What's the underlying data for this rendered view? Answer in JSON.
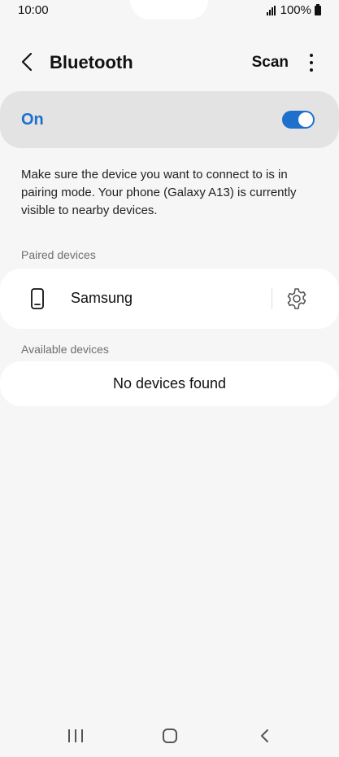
{
  "status_bar": {
    "time": "10:00",
    "battery": "100%",
    "icons": [
      "signal-icon",
      "battery-icon"
    ]
  },
  "header": {
    "title": "Bluetooth",
    "scan_label": "Scan",
    "icons": [
      "back-arrow-icon",
      "more-options-icon"
    ]
  },
  "master_switch": {
    "label": "On",
    "state": "on",
    "accent_color": "#1f6fcd"
  },
  "description": "Make sure the device you want to connect to is in pairing mode. Your phone (Galaxy A13) is currently visible to nearby devices.",
  "paired_devices": {
    "label": "Paired devices",
    "items": [
      {
        "name": "Samsung",
        "icon": "phone-icon",
        "action_icon": "gear-icon"
      }
    ]
  },
  "available_devices": {
    "label": "Available devices",
    "empty_text": "No devices found"
  },
  "nav_bar": {
    "icons": [
      "recents-icon",
      "home-icon",
      "back-icon"
    ]
  }
}
